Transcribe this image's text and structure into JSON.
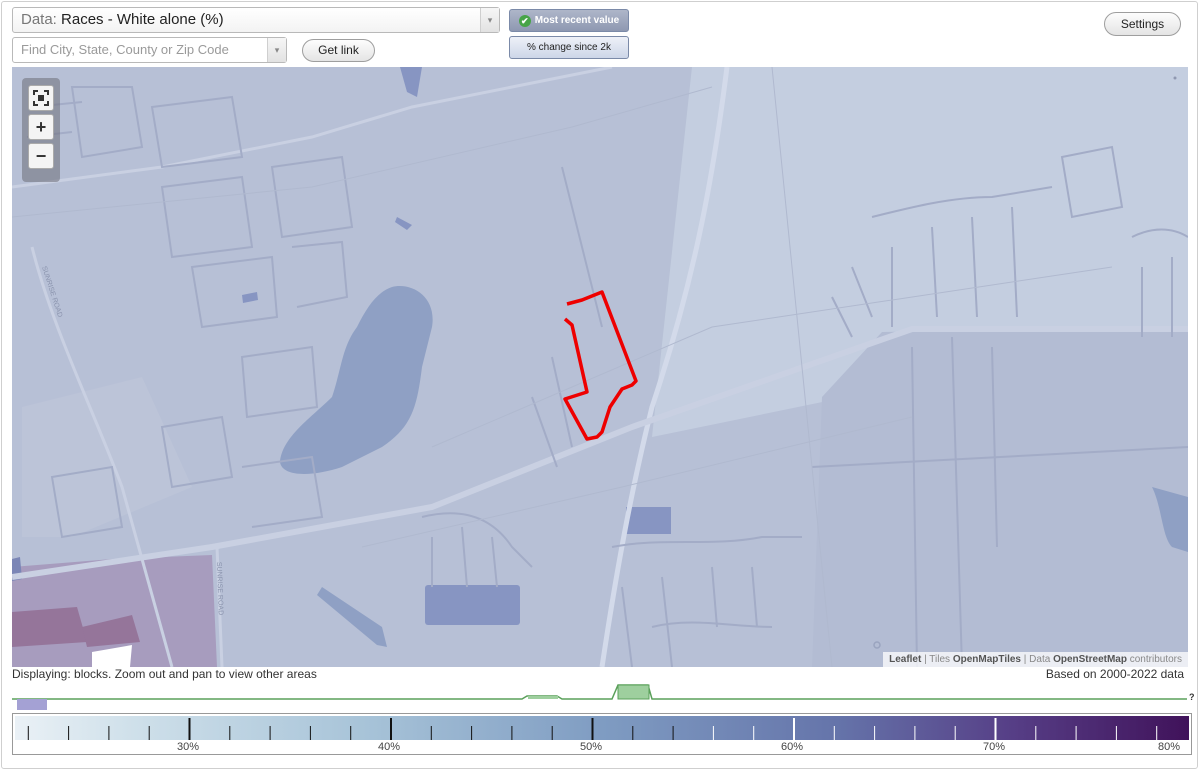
{
  "controls": {
    "data_label": "Data:",
    "data_value": "Races - White alone (%)",
    "find_placeholder": "Find City, State, County or Zip Code",
    "get_link": "Get link",
    "most_recent": "Most recent value",
    "pct_change": "% change since 2k",
    "settings": "Settings",
    "dropdown_arrow": "▾"
  },
  "map": {
    "zoom_in": "+",
    "zoom_out": "−",
    "fullscreen_icon": "fullscreen-icon",
    "attribution": {
      "leaflet": "Leaflet",
      "sep1": " | Tiles ",
      "tiles": "OpenMapTiles",
      "sep2": " | Data ",
      "data": "OpenStreetMap",
      "contrib": " contributors"
    },
    "road_label_1": "SUNRISE ROAD",
    "road_label_2": "SUNRISE ROAD",
    "highlight_color": "#ee0000"
  },
  "footer": {
    "displaying": "Displaying: blocks. Zoom out and pan to view other areas",
    "based_on": "Based on 2000-2022 data",
    "question": "?"
  },
  "scale": {
    "labels": [
      "30%",
      "40%",
      "50%",
      "60%",
      "70%",
      "80%"
    ]
  }
}
